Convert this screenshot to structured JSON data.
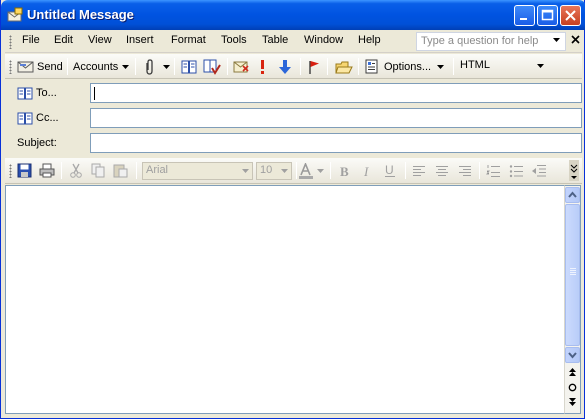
{
  "window": {
    "title": "Untitled Message"
  },
  "menu": {
    "items": [
      {
        "label": "File"
      },
      {
        "label": "Edit"
      },
      {
        "label": "View"
      },
      {
        "label": "Insert"
      },
      {
        "label": "Format"
      },
      {
        "label": "Tools"
      },
      {
        "label": "Table"
      },
      {
        "label": "Window"
      },
      {
        "label": "Help"
      }
    ],
    "help_placeholder": "Type a question for help"
  },
  "standard_toolbar": {
    "send_label": "Send",
    "accounts_label": "Accounts",
    "options_label": "Options...",
    "format_value": "HTML"
  },
  "fields": {
    "to_label": "To...",
    "cc_label": "Cc...",
    "subject_label": "Subject:"
  },
  "format_toolbar": {
    "font_value": "Arial",
    "size_value": "10"
  },
  "colors": {
    "titlebar": "#0053e1",
    "chrome": "#ece9d8",
    "input_border": "#7f9db9"
  }
}
